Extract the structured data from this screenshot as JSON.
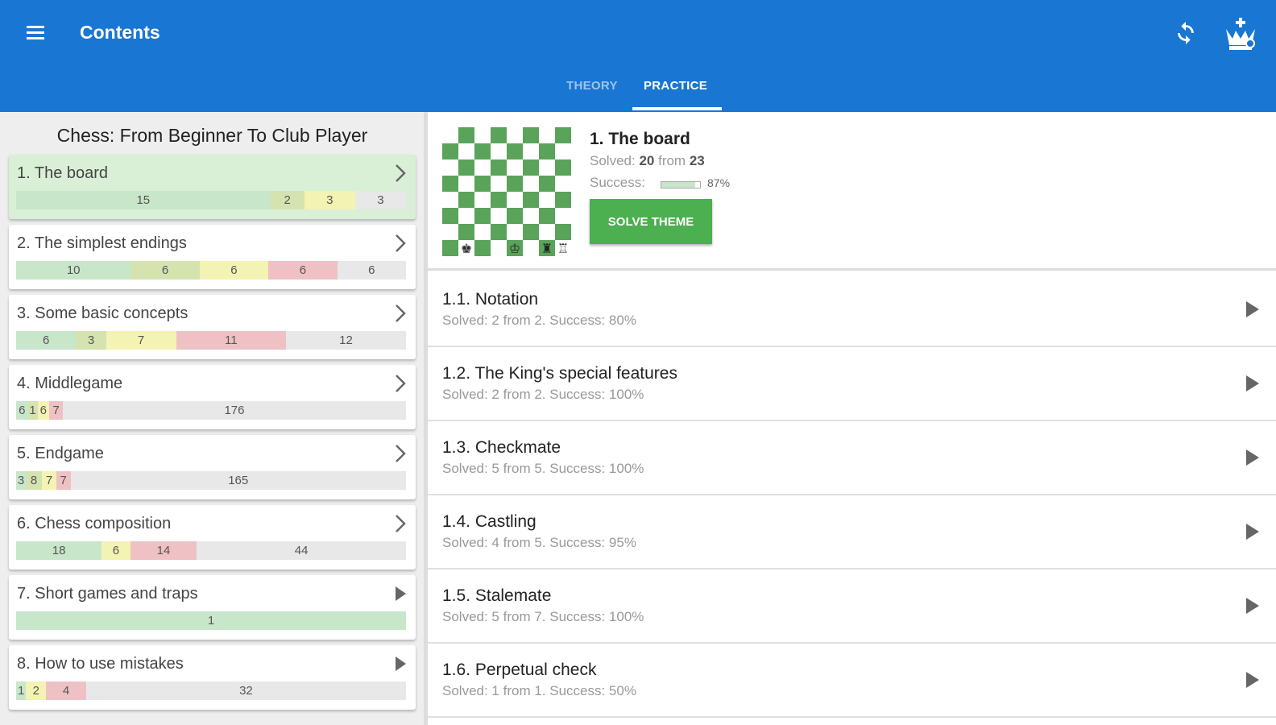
{
  "appbar": {
    "title": "Contents",
    "tabs": [
      {
        "label": "THEORY",
        "active": false
      },
      {
        "label": "PRACTICE",
        "active": true
      }
    ],
    "icons": {
      "menu": "hamburger-menu-icon",
      "sync": "sync-icon",
      "profile": "chess-king-icon"
    },
    "color": "#1976d2"
  },
  "course": {
    "title": "Chess: From Beginner To Club Player",
    "chapters": [
      {
        "name": "1. The board",
        "selected": true,
        "expand_icon": "chevron",
        "segments": [
          {
            "label": "15",
            "value": 15,
            "kind": "g1"
          },
          {
            "label": "2",
            "value": 2,
            "kind": "g2"
          },
          {
            "label": "3",
            "value": 3,
            "kind": "y"
          },
          {
            "label": "3",
            "value": 3,
            "kind": "e"
          }
        ]
      },
      {
        "name": "2. The simplest endings",
        "selected": false,
        "expand_icon": "chevron",
        "segments": [
          {
            "label": "10",
            "value": 10,
            "kind": "g1"
          },
          {
            "label": "6",
            "value": 6,
            "kind": "g2"
          },
          {
            "label": "6",
            "value": 6,
            "kind": "y"
          },
          {
            "label": "6",
            "value": 6,
            "kind": "r"
          },
          {
            "label": "6",
            "value": 6,
            "kind": "e"
          }
        ]
      },
      {
        "name": "3. Some basic concepts",
        "selected": false,
        "expand_icon": "chevron",
        "segments": [
          {
            "label": "6",
            "value": 6,
            "kind": "g1"
          },
          {
            "label": "3",
            "value": 3,
            "kind": "g2"
          },
          {
            "label": "7",
            "value": 7,
            "kind": "y"
          },
          {
            "label": "11",
            "value": 11,
            "kind": "r"
          },
          {
            "label": "12",
            "value": 12,
            "kind": "e"
          }
        ]
      },
      {
        "name": "4. Middlegame",
        "selected": false,
        "expand_icon": "chevron",
        "segments": [
          {
            "label": "6",
            "value": 6,
            "kind": "g1"
          },
          {
            "label": "1",
            "value": 1,
            "kind": "g2"
          },
          {
            "label": "6",
            "value": 6,
            "kind": "y"
          },
          {
            "label": "7",
            "value": 7,
            "kind": "r"
          },
          {
            "label": "176",
            "value": 176,
            "kind": "e"
          }
        ]
      },
      {
        "name": "5. Endgame",
        "selected": false,
        "expand_icon": "chevron",
        "segments": [
          {
            "label": "3",
            "value": 3,
            "kind": "g1"
          },
          {
            "label": "8",
            "value": 8,
            "kind": "g2"
          },
          {
            "label": "7",
            "value": 7,
            "kind": "y"
          },
          {
            "label": "7",
            "value": 7,
            "kind": "r"
          },
          {
            "label": "165",
            "value": 165,
            "kind": "e"
          }
        ]
      },
      {
        "name": "6. Chess composition",
        "selected": false,
        "expand_icon": "chevron",
        "segments": [
          {
            "label": "18",
            "value": 18,
            "kind": "g1"
          },
          {
            "label": "6",
            "value": 6,
            "kind": "y"
          },
          {
            "label": "14",
            "value": 14,
            "kind": "r"
          },
          {
            "label": "44",
            "value": 44,
            "kind": "e"
          }
        ]
      },
      {
        "name": "7. Short games and traps",
        "selected": false,
        "expand_icon": "play",
        "segments": [
          {
            "label": "1",
            "value": 1,
            "kind": "g1"
          }
        ]
      },
      {
        "name": "8. How to use mistakes",
        "selected": false,
        "expand_icon": "play",
        "segments": [
          {
            "label": "1",
            "value": 1,
            "kind": "g1"
          },
          {
            "label": "2",
            "value": 2,
            "kind": "y"
          },
          {
            "label": "4",
            "value": 4,
            "kind": "r"
          },
          {
            "label": "32",
            "value": 32,
            "kind": "e"
          }
        ]
      }
    ]
  },
  "theme": {
    "title": "1. The board",
    "solved_prefix": "Solved:",
    "solved": "20",
    "from_word": "from",
    "total": "23",
    "success_label": "Success:",
    "success_fraction": 0.87,
    "success_pct": "87%",
    "button_label": "SOLVE THEME",
    "board_icon": "chessboard-thumbnail"
  },
  "lessons": [
    {
      "name": "1.1. Notation",
      "sub": "Solved: 2 from 2. Success: 80%"
    },
    {
      "name": "1.2. The King's special features",
      "sub": "Solved: 2 from 2. Success: 100%"
    },
    {
      "name": "1.3. Checkmate",
      "sub": "Solved: 5 from 5. Success: 100%"
    },
    {
      "name": "1.4. Castling",
      "sub": "Solved: 4 from 5. Success: 95%"
    },
    {
      "name": "1.5. Stalemate",
      "sub": "Solved: 5 from 7. Success: 100%"
    },
    {
      "name": "1.6. Perpetual check",
      "sub": "Solved: 1 from 1. Success: 50%"
    }
  ]
}
